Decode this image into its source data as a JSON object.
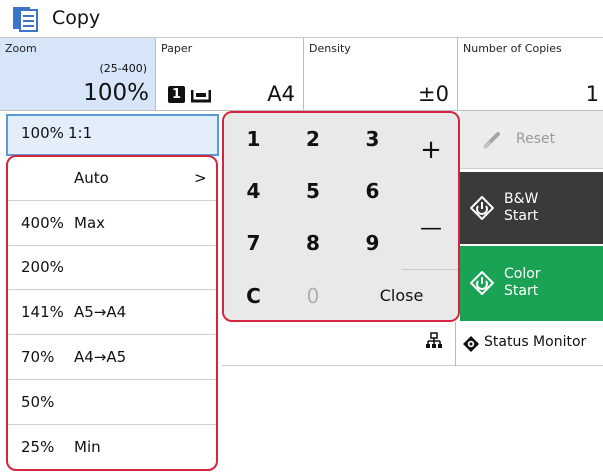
{
  "app": {
    "title": "Copy"
  },
  "settings": {
    "zoom": {
      "label": "Zoom",
      "range": "(25-400)",
      "value": "100%"
    },
    "paper": {
      "label": "Paper",
      "tray": "1",
      "value": "A4"
    },
    "density": {
      "label": "Density",
      "value": "±0"
    },
    "copies": {
      "label": "Number of Copies",
      "value": "1"
    }
  },
  "zoom_list": [
    {
      "pct": "100%",
      "desc": "1:1"
    },
    {
      "pct": "",
      "desc": "Auto",
      "arrow": ">"
    },
    {
      "pct": "400%",
      "desc": "Max"
    },
    {
      "pct": "200%",
      "desc": ""
    },
    {
      "pct": "141%",
      "desc": "A5→A4"
    },
    {
      "pct": "70%",
      "desc": "A4→A5"
    },
    {
      "pct": "50%",
      "desc": ""
    },
    {
      "pct": "25%",
      "desc": "Min"
    }
  ],
  "keypad": {
    "keys": [
      "1",
      "2",
      "3",
      "4",
      "5",
      "6",
      "7",
      "8",
      "9",
      "C",
      "0"
    ],
    "plus": "+",
    "minus": "—",
    "close": "Close"
  },
  "actions": {
    "reset": "Reset",
    "bw_start": [
      "B&W",
      "Start"
    ],
    "color_start": [
      "Color",
      "Start"
    ]
  },
  "status": {
    "monitor": "Status Monitor"
  },
  "colors": {
    "highlight": "#d6243e",
    "bw": "#3a3a3a",
    "color_start": "#1aa354",
    "zoom_selected": "#d6e6f8"
  }
}
